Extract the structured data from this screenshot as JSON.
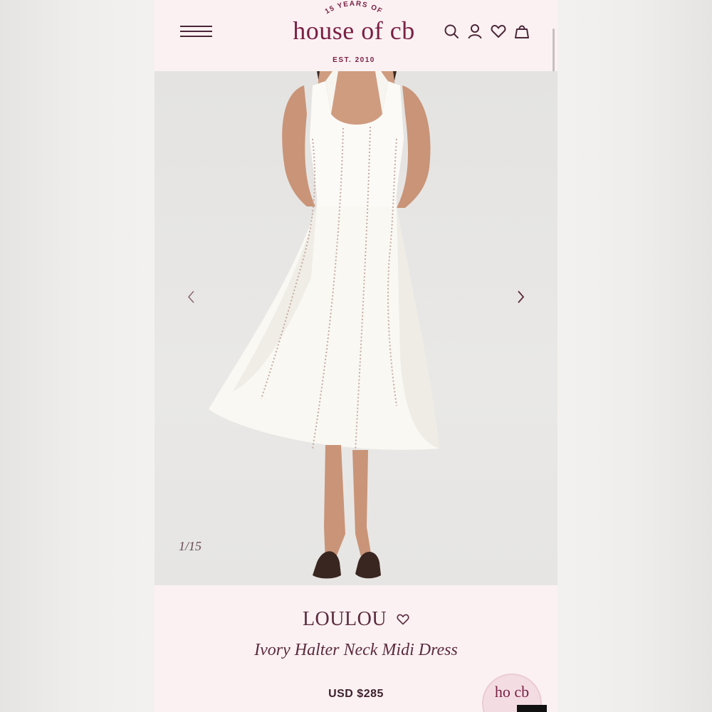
{
  "header": {
    "logo_arc": "15 YEARS OF",
    "logo_word": "house of cb",
    "logo_est": "EST. 2010",
    "icons": [
      "search-icon",
      "account-icon",
      "wishlist-icon",
      "bag-icon"
    ]
  },
  "gallery": {
    "counter": "1/15",
    "prev_icon": "chevron-left-icon",
    "next_icon": "chevron-right-icon"
  },
  "product": {
    "brand": "LOULOU",
    "title": "Ivory Halter Neck Midi Dress",
    "price": "USD $285",
    "badge_text": "ho cb"
  },
  "colors": {
    "brand": "#7a1f44",
    "background": "#fbf1f2",
    "text_dark": "#3e1f2c"
  }
}
